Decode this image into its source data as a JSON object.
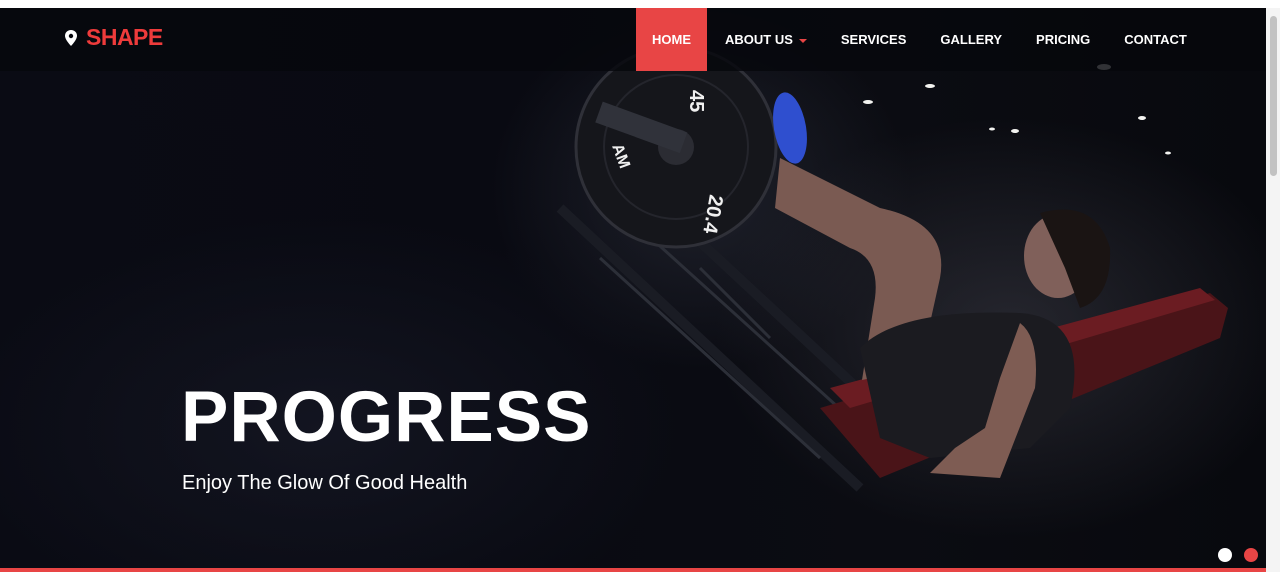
{
  "brand": {
    "logo_text": "SHAPE",
    "logo_icon": "map-pin-icon",
    "accent_color": "#e84545"
  },
  "nav": {
    "items": [
      {
        "label": "HOME",
        "active": true
      },
      {
        "label": "ABOUT US",
        "has_dropdown": true
      },
      {
        "label": "SERVICES"
      },
      {
        "label": "GALLERY"
      },
      {
        "label": "PRICING"
      },
      {
        "label": "CONTACT"
      }
    ]
  },
  "hero": {
    "title": "PROGRESS",
    "subtitle": "Enjoy The Glow Of Good Health",
    "plate_text_1": "45",
    "plate_text_2": "20.4",
    "plate_text_3": "AM"
  },
  "slider": {
    "active_index": 1,
    "total": 2
  }
}
